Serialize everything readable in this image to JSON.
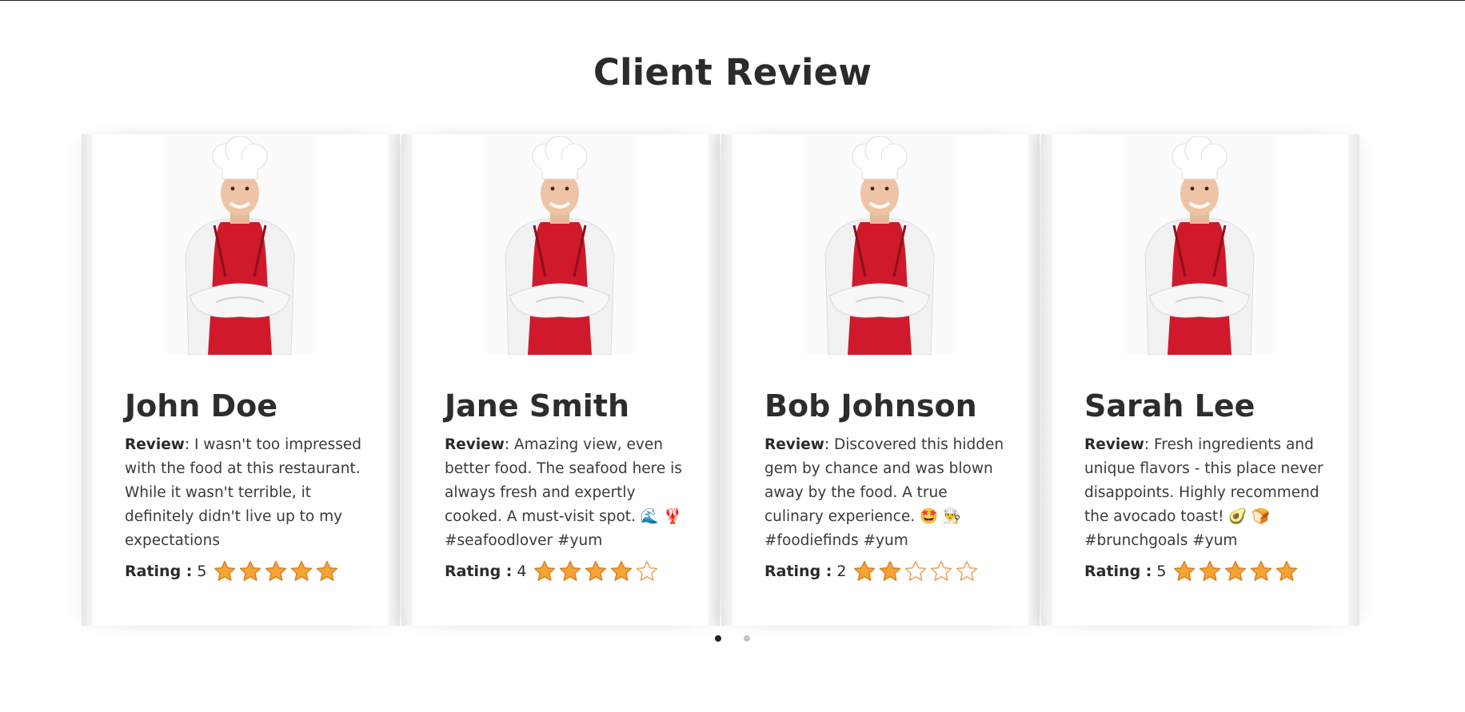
{
  "section": {
    "title": "Client Review"
  },
  "reviews": [
    {
      "name": "John Doe",
      "review_label": "Review",
      "review_text": ": I wasn't too impressed with the food at this restaurant. While it wasn't terrible, it definitely didn't live up to my expectations",
      "rating_label": "Rating :",
      "rating_value": "5",
      "rating": 5
    },
    {
      "name": "Jane Smith",
      "review_label": "Review",
      "review_text": ": Amazing view, even better food. The seafood here is always fresh and expertly cooked. A must-visit spot. 🌊 🦞 #seafoodlover #yum",
      "rating_label": "Rating :",
      "rating_value": "4",
      "rating": 4
    },
    {
      "name": "Bob Johnson",
      "review_label": "Review",
      "review_text": ": Discovered this hidden gem by chance and was blown away by the food. A true culinary experience. 🤩 👨‍🍳 #foodiefinds #yum",
      "rating_label": "Rating :",
      "rating_value": "2",
      "rating": 2
    },
    {
      "name": "Sarah Lee",
      "review_label": "Review",
      "review_text": ": Fresh ingredients and unique flavors - this place never disappoints. Highly recommend the avocado toast! 🥑 🍞 #brunchgoals #yum",
      "rating_label": "Rating :",
      "rating_value": "5",
      "rating": 5
    }
  ],
  "pagination": {
    "pages": 2,
    "active": 0
  },
  "colors": {
    "star_fill": "#f5a431",
    "star_stroke": "#d9822b",
    "star_empty_stroke": "#e8a45a",
    "apron": "#d0192b",
    "title": "#2b2b2b"
  },
  "icons": {
    "star": "star-icon",
    "empty_star": "star-outline-icon",
    "photo": "chef-photo"
  }
}
